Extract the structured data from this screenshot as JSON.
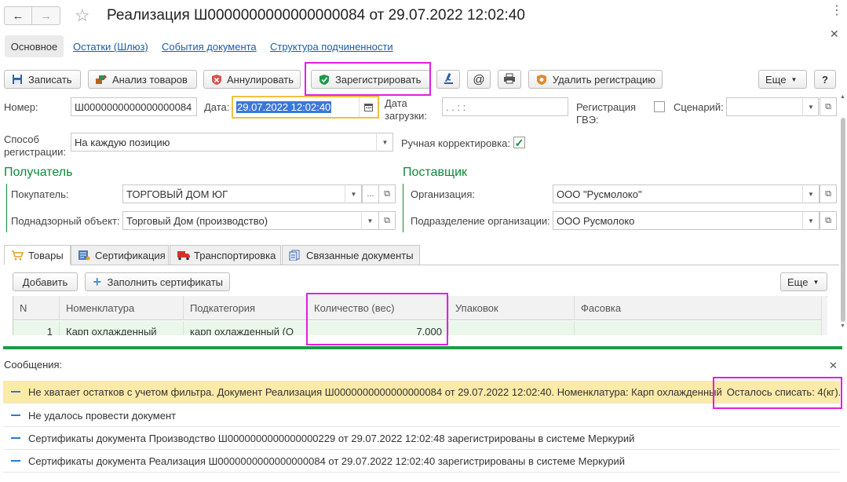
{
  "window": {
    "title": "Реализация Ш0000000000000000084 от 29.07.2022 12:02:40"
  },
  "nav_tabs": [
    {
      "label": "Основное"
    },
    {
      "label": "Остатки (Шлюз)"
    },
    {
      "label": "События документа"
    },
    {
      "label": "Структура подчиненности"
    }
  ],
  "toolbar": {
    "save": "Записать",
    "analysis": "Анализ товаров",
    "cancel": "Аннулировать",
    "register": "Зарегистрировать",
    "delete_reg": "Удалить регистрацию",
    "more": "Еще",
    "help": "?",
    "email": "@"
  },
  "form": {
    "number_label": "Номер:",
    "number_value": "Ш0000000000000000084",
    "date_label": "Дата:",
    "date_value": "29.07.2022 12:02:40",
    "load_date_label_1": "Дата",
    "load_date_label_2": "загрузки:",
    "load_date_value": " .  .       :  :",
    "gve_label_1": "Регистрация",
    "gve_label_2": "ГВЭ:",
    "scenario_label": "Сценарий:",
    "scenario_value": "",
    "method_label_1": "Способ",
    "method_label_2": "регистрации:",
    "method_value": "На каждую позицию",
    "manual_label": "Ручная корректировка:"
  },
  "recipient": {
    "title": "Получатель",
    "buyer_label": "Покупатель:",
    "buyer_value": "ТОРГОВЫЙ ДОМ ЮГ",
    "object_label": "Поднадзорный объект:",
    "object_value": "Торговый Дом (производство)"
  },
  "supplier": {
    "title": "Поставщик",
    "org_label": "Организация:",
    "org_value": "ООО \"Русмолоко\"",
    "dept_label": "Подразделение организации:",
    "dept_value": "ООО Русмолоко"
  },
  "doc_tabs": [
    {
      "label": "Товары"
    },
    {
      "label": "Сертификация"
    },
    {
      "label": "Транспортировка"
    },
    {
      "label": "Связанные документы"
    }
  ],
  "table_toolbar": {
    "add": "Добавить",
    "fill": "Заполнить сертификаты",
    "more": "Еще"
  },
  "table": {
    "columns": [
      "N",
      "Номенклатура",
      "Подкатегория",
      "Количество (вес)",
      "Упаковок",
      "Фасовка"
    ],
    "rows": [
      {
        "n": "1",
        "name": "Карп охлажденный",
        "sub": "карп охлажденный (О",
        "qty": "7,000",
        "packs": "",
        "fas": ""
      }
    ]
  },
  "messages": {
    "title": "Сообщения:",
    "items": [
      {
        "text": "Не хватает остатков с учетом фильтра. Документ Реализация Ш0000000000000000084 от 29.07.2022 12:02:40. Номенклатура: Карп охлажденный",
        "highlight": "Осталось списать: 4(кг)."
      },
      {
        "text": "Не удалось провести документ"
      },
      {
        "text": "Сертификаты документа Производство Ш0000000000000000229 от 29.07.2022 12:02:48 зарегистрированы в системе Меркурий"
      },
      {
        "text": "Сертификаты документа Реализация Ш0000000000000000084 от 29.07.2022 12:02:40 зарегистрированы в системе Меркурий"
      }
    ]
  },
  "colors": {
    "accent_green": "#0d8a3a",
    "link_blue": "#1a5fa8",
    "highlight_magenta": "#e020e0",
    "warning_bg": "#fbeaa8",
    "selection_blue": "#3a78d8",
    "row_green": "#eaf7ea"
  }
}
